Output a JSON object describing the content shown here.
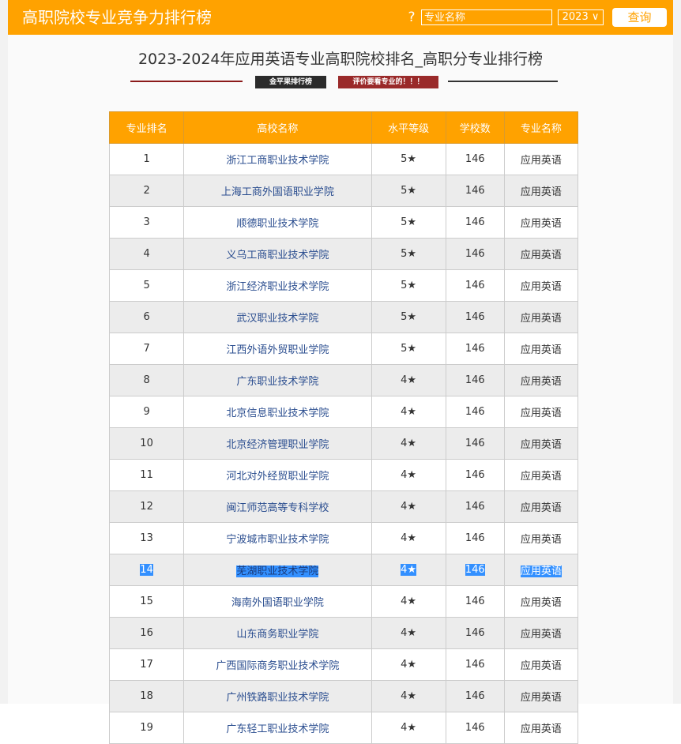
{
  "header": {
    "site_title": "高职院校专业竞争力排行榜",
    "help_icon": "?",
    "search_placeholder": "专业名称",
    "year_select": "2023 ∨",
    "query_label": "查询"
  },
  "page": {
    "title": "2023-2024年应用英语专业高职院校排名_高职分专业排行榜",
    "badge_left": "金平果排行榜",
    "badge_right": "评价要看专业的！！！"
  },
  "table": {
    "columns": [
      "专业排名",
      "高校名称",
      "水平等级",
      "学校数",
      "专业名称"
    ],
    "selected_row": 14,
    "rows": [
      {
        "rank": "1",
        "school": "浙江工商职业技术学院",
        "level": "5★",
        "count": "146",
        "major": "应用英语"
      },
      {
        "rank": "2",
        "school": "上海工商外国语职业学院",
        "level": "5★",
        "count": "146",
        "major": "应用英语"
      },
      {
        "rank": "3",
        "school": "顺德职业技术学院",
        "level": "5★",
        "count": "146",
        "major": "应用英语"
      },
      {
        "rank": "4",
        "school": "义乌工商职业技术学院",
        "level": "5★",
        "count": "146",
        "major": "应用英语"
      },
      {
        "rank": "5",
        "school": "浙江经济职业技术学院",
        "level": "5★",
        "count": "146",
        "major": "应用英语"
      },
      {
        "rank": "6",
        "school": "武汉职业技术学院",
        "level": "5★",
        "count": "146",
        "major": "应用英语"
      },
      {
        "rank": "7",
        "school": "江西外语外贸职业学院",
        "level": "5★",
        "count": "146",
        "major": "应用英语"
      },
      {
        "rank": "8",
        "school": "广东职业技术学院",
        "level": "4★",
        "count": "146",
        "major": "应用英语"
      },
      {
        "rank": "9",
        "school": "北京信息职业技术学院",
        "level": "4★",
        "count": "146",
        "major": "应用英语"
      },
      {
        "rank": "10",
        "school": "北京经济管理职业学院",
        "level": "4★",
        "count": "146",
        "major": "应用英语"
      },
      {
        "rank": "11",
        "school": "河北对外经贸职业学院",
        "level": "4★",
        "count": "146",
        "major": "应用英语"
      },
      {
        "rank": "12",
        "school": "闽江师范高等专科学校",
        "level": "4★",
        "count": "146",
        "major": "应用英语"
      },
      {
        "rank": "13",
        "school": "宁波城市职业技术学院",
        "level": "4★",
        "count": "146",
        "major": "应用英语"
      },
      {
        "rank": "14",
        "school": "芜湖职业技术学院",
        "level": "4★",
        "count": "146",
        "major": "应用英语"
      },
      {
        "rank": "15",
        "school": "海南外国语职业学院",
        "level": "4★",
        "count": "146",
        "major": "应用英语"
      },
      {
        "rank": "16",
        "school": "山东商务职业学院",
        "level": "4★",
        "count": "146",
        "major": "应用英语"
      },
      {
        "rank": "17",
        "school": "广西国际商务职业技术学院",
        "level": "4★",
        "count": "146",
        "major": "应用英语"
      },
      {
        "rank": "18",
        "school": "广州铁路职业技术学院",
        "level": "4★",
        "count": "146",
        "major": "应用英语"
      },
      {
        "rank": "19",
        "school": "广东轻工职业技术学院",
        "level": "4★",
        "count": "146",
        "major": "应用英语"
      }
    ]
  },
  "colors": {
    "accent": "#ffa200",
    "link": "#2a4d8f",
    "selection": "#3390ff"
  }
}
